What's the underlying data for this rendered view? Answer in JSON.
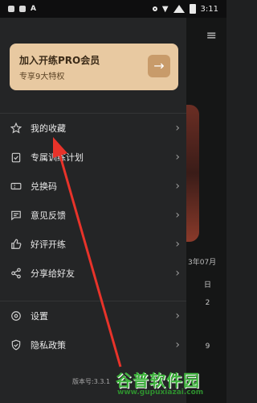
{
  "status_bar": {
    "time": "3:11",
    "left_icons": [
      "app-icon",
      "app-icon",
      "a-icon"
    ],
    "right_icons": [
      "location-icon",
      "wifi-icon",
      "signal-icon",
      "battery-icon"
    ]
  },
  "vip_banner": {
    "title": "加入开练PRO会员",
    "subtitle": "专享9大特权",
    "arrow": "→"
  },
  "menu_group_1": [
    {
      "label": "我的收藏",
      "icon": "star-icon"
    },
    {
      "label": "专属训练计划",
      "icon": "clipboard-icon"
    },
    {
      "label": "兑换码",
      "icon": "ticket-icon"
    },
    {
      "label": "意见反馈",
      "icon": "feedback-icon"
    },
    {
      "label": "好评开练",
      "icon": "thumbs-up-icon"
    },
    {
      "label": "分享给好友",
      "icon": "share-icon"
    }
  ],
  "menu_group_2": [
    {
      "label": "设置",
      "icon": "settings-icon"
    },
    {
      "label": "隐私政策",
      "icon": "shield-icon"
    }
  ],
  "version": "版本号:3.3.1",
  "background": {
    "menu_icon": "≡",
    "month": "3年07月",
    "weekday": "日",
    "day1": "2",
    "day2": "9"
  },
  "watermark": {
    "title": "谷普软件园",
    "url": "www.gupuxiazai.com"
  },
  "colors": {
    "drawer_bg": "#242526",
    "vip_bg": "#e8c9a1",
    "annotation": "#e8332a",
    "watermark": "#3fb23e"
  }
}
